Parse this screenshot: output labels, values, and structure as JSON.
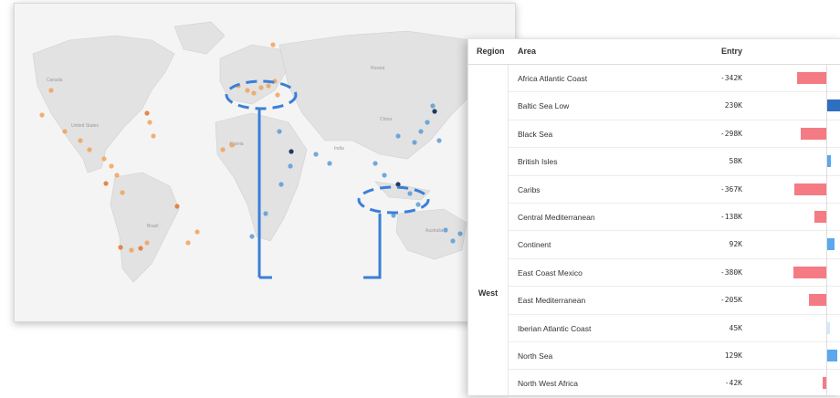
{
  "map": {
    "region_labels": [
      "Canada",
      "United States",
      "Brazil",
      "Algeria",
      "Russia",
      "China",
      "India",
      "Australia"
    ],
    "colors": {
      "land": "#e3e3e3",
      "ocean": "#f2f2f2",
      "orange": "#f0a25a",
      "darkorange": "#e0742f",
      "blue": "#5b9bd5",
      "navy": "#1f3a5f",
      "annotation": "#3a7fd8"
    }
  },
  "table": {
    "headers": {
      "region": "Region",
      "area": "Area",
      "entry": "Entry"
    },
    "region": "West",
    "rows": [
      {
        "area": "Africa Atlantic Coast",
        "entry": "-342K",
        "value": -342
      },
      {
        "area": "Baltic Sea Low",
        "entry": "230K",
        "value": 230
      },
      {
        "area": "Black Sea",
        "entry": "-298K",
        "value": -298
      },
      {
        "area": "British Isles",
        "entry": "58K",
        "value": 58
      },
      {
        "area": "Caribs",
        "entry": "-367K",
        "value": -367
      },
      {
        "area": "Central Mediterranean",
        "entry": "-138K",
        "value": -138
      },
      {
        "area": "Continent",
        "entry": "92K",
        "value": 92
      },
      {
        "area": "East Coast Mexico",
        "entry": "-380K",
        "value": -380
      },
      {
        "area": "East Mediterranean",
        "entry": "-205K",
        "value": -205
      },
      {
        "area": "Iberian Atlantic Coast",
        "entry": "45K",
        "value": 45
      },
      {
        "area": "North Sea",
        "entry": "129K",
        "value": 129
      },
      {
        "area": "North West Africa",
        "entry": "-42K",
        "value": -42
      }
    ],
    "colors": {
      "negative": "#f47b84",
      "positive_strong": "#2f6fbf",
      "positive": "#5aa7ee",
      "positive_light": "#d6e8fb"
    }
  }
}
